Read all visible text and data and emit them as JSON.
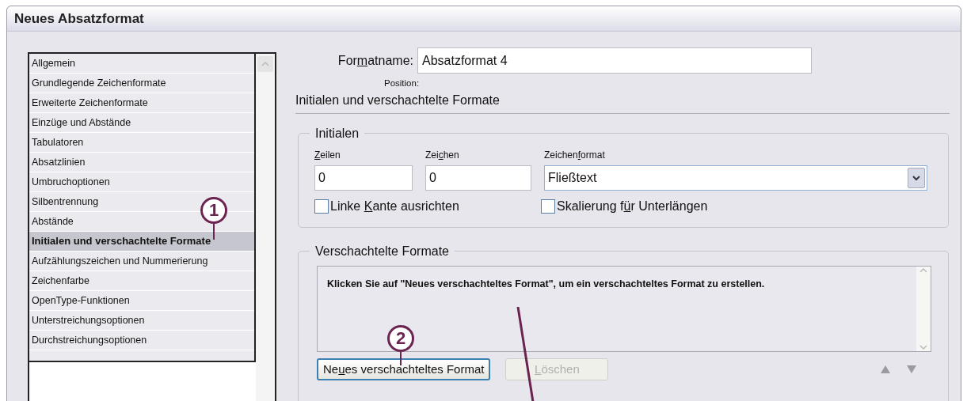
{
  "window": {
    "title": "Neues Absatzformat"
  },
  "sidebar": {
    "items": [
      {
        "label": "Allgemein",
        "selected": false
      },
      {
        "label": "Grundlegende Zeichenformate",
        "selected": false
      },
      {
        "label": "Erweiterte Zeichenformate",
        "selected": false
      },
      {
        "label": "Einzüge und Abstände",
        "selected": false
      },
      {
        "label": "Tabulatoren",
        "selected": false
      },
      {
        "label": "Absatzlinien",
        "selected": false
      },
      {
        "label": "Umbruchoptionen",
        "selected": false
      },
      {
        "label": "Silbentrennung",
        "selected": false
      },
      {
        "label": "Abstände",
        "selected": false
      },
      {
        "label": "Initialen und verschachtelte Formate",
        "selected": true
      },
      {
        "label": "Aufzählungszeichen und Nummerierung",
        "selected": false
      },
      {
        "label": "Zeichenfarbe",
        "selected": false
      },
      {
        "label": "OpenType-Funktionen",
        "selected": false
      },
      {
        "label": "Unterstreichungsoptionen",
        "selected": false
      },
      {
        "label": "Durchstreichungsoptionen",
        "selected": false
      }
    ]
  },
  "format_name": {
    "label_parts": [
      {
        "text": "For",
        "underlined": false
      },
      {
        "text": "m",
        "underlined": true
      },
      {
        "text": "atname:",
        "underlined": false
      }
    ],
    "value": "Absatzformat 4"
  },
  "position_label": "Position:",
  "section_title": "Initialen und verschachtelte Formate",
  "initials": {
    "title": "Initialen",
    "fields": [
      {
        "label_parts": [
          {
            "text": "Z",
            "underlined": true
          },
          {
            "text": "eilen",
            "underlined": false
          }
        ],
        "value": "0",
        "kind": "text"
      },
      {
        "label_parts": [
          {
            "text": "Zei",
            "underlined": false
          },
          {
            "text": "c",
            "underlined": true
          },
          {
            "text": "hen",
            "underlined": false
          }
        ],
        "value": "0",
        "kind": "text"
      },
      {
        "label_parts": [
          {
            "text": "Zeichen",
            "underlined": false
          },
          {
            "text": "f",
            "underlined": true
          },
          {
            "text": "ormat",
            "underlined": false
          }
        ],
        "value": "Fließtext",
        "kind": "select"
      }
    ],
    "checkboxes": [
      {
        "label_parts": [
          {
            "text": "Linke ",
            "underlined": false
          },
          {
            "text": "K",
            "underlined": true
          },
          {
            "text": "ante ausrichten",
            "underlined": false
          }
        ],
        "checked": false
      },
      {
        "label_parts": [
          {
            "text": "Skalierung f",
            "underlined": false
          },
          {
            "text": "ü",
            "underlined": true
          },
          {
            "text": "r Unterlängen",
            "underlined": false
          }
        ],
        "checked": false
      }
    ]
  },
  "nested": {
    "title": "Verschachtelte Formate",
    "message": "Klicken Sie auf \"Neues verschachteltes Format\", um ein verschachteltes Format zu erstellen.",
    "buttons": [
      {
        "label_parts": [
          {
            "text": "Ne",
            "underlined": false
          },
          {
            "text": "u",
            "underlined": true
          },
          {
            "text": "es verschachteltes Format",
            "underlined": false
          }
        ],
        "disabled": false
      },
      {
        "label_parts": [
          {
            "text": "L",
            "underlined": true
          },
          {
            "text": "öschen",
            "underlined": false
          }
        ],
        "disabled": true
      }
    ],
    "move_up_disabled": true,
    "move_down_disabled": true
  },
  "annotations": [
    {
      "label": "1"
    },
    {
      "label": "2"
    }
  ]
}
